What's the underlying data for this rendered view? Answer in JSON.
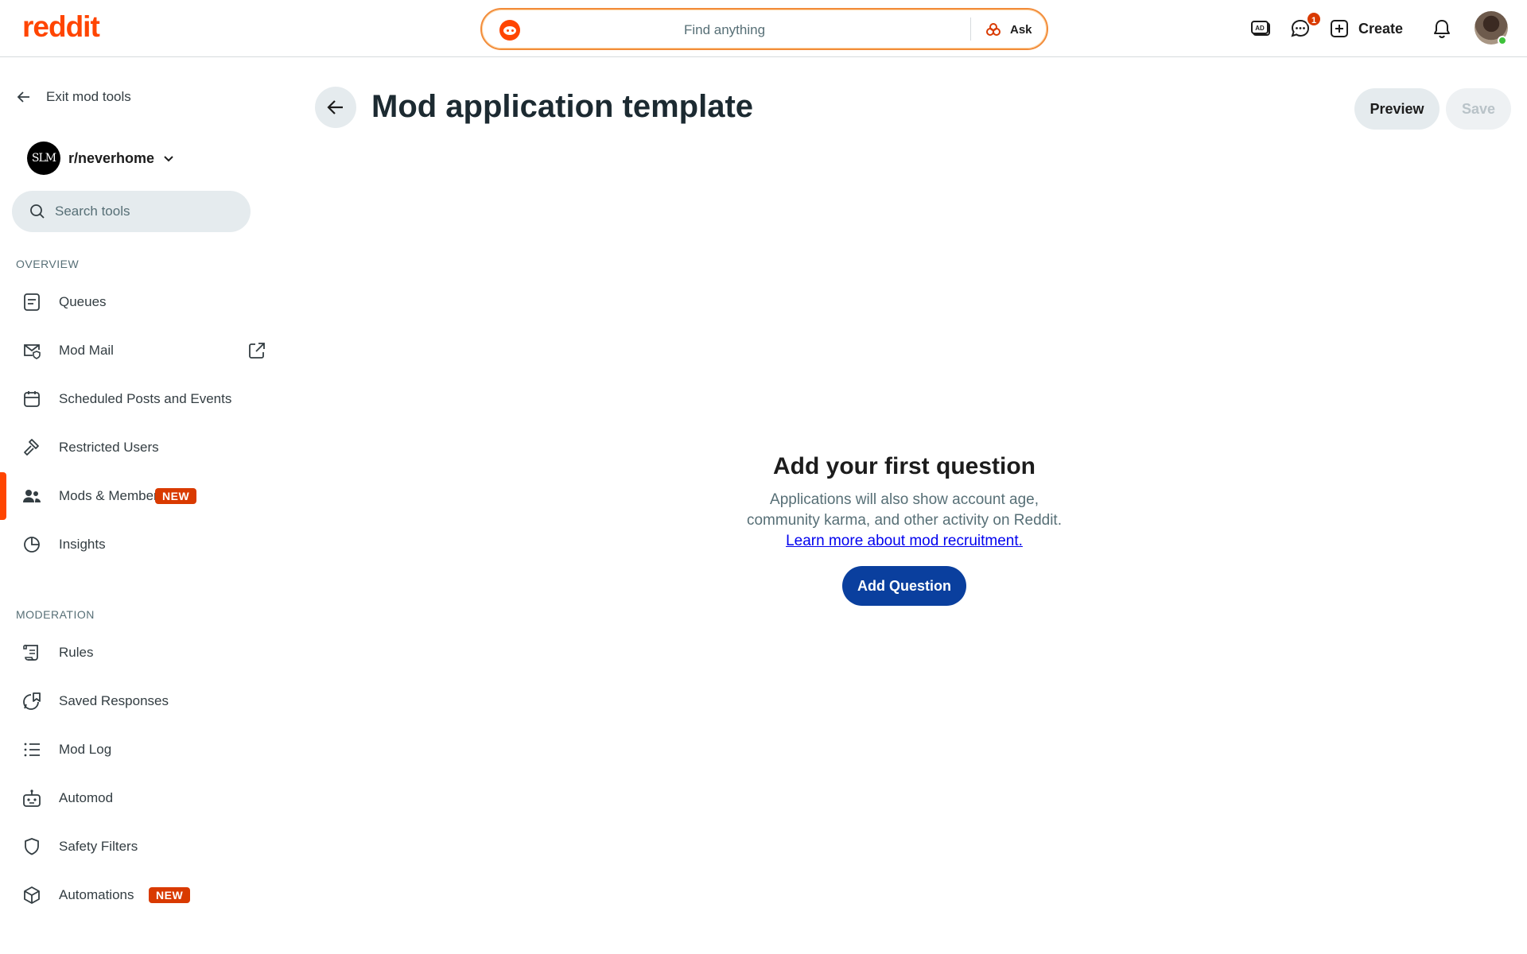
{
  "header": {
    "logo": "reddit",
    "search_placeholder": "Find anything",
    "ask_label": "Ask",
    "chat_badge": "1",
    "create_label": "Create"
  },
  "sidebar": {
    "exit_label": "Exit mod tools",
    "subreddit_avatar_text": "SLM",
    "subreddit_name": "r/neverhome",
    "search_placeholder": "Search tools",
    "overview_heading": "OVERVIEW",
    "overview_items": [
      {
        "label": "Queues",
        "icon": "queue-icon"
      },
      {
        "label": "Mod Mail",
        "icon": "mod-mail-icon"
      },
      {
        "label": "Scheduled Posts and Events",
        "icon": "calendar-icon"
      },
      {
        "label": "Restricted Users",
        "icon": "hammer-icon"
      },
      {
        "label": "Mods & Members",
        "icon": "members-icon",
        "badge": "NEW",
        "active": true
      },
      {
        "label": "Insights",
        "icon": "pie-chart-icon"
      }
    ],
    "moderation_heading": "MODERATION",
    "moderation_items": [
      {
        "label": "Rules",
        "icon": "rules-scroll-icon"
      },
      {
        "label": "Saved Responses",
        "icon": "saved-responses-icon"
      },
      {
        "label": "Mod Log",
        "icon": "list-icon"
      },
      {
        "label": "Automod",
        "icon": "robot-icon"
      },
      {
        "label": "Safety Filters",
        "icon": "shield-icon"
      },
      {
        "label": "Automations",
        "icon": "cube-icon",
        "badge": "NEW"
      }
    ]
  },
  "main": {
    "title": "Mod application template",
    "preview_label": "Preview",
    "save_label": "Save",
    "empty_title": "Add your first question",
    "empty_desc_line1": "Applications will also show account age,",
    "empty_desc_line2": "community karma, and other activity on Reddit.",
    "learn_more_link": "Learn more about mod recruitment.",
    "add_question_label": "Add Question"
  },
  "colors": {
    "brand": "#ff4500",
    "badge": "#d93a00",
    "primary_button": "#0a3f9e",
    "neutral_button": "#e5ebee"
  }
}
